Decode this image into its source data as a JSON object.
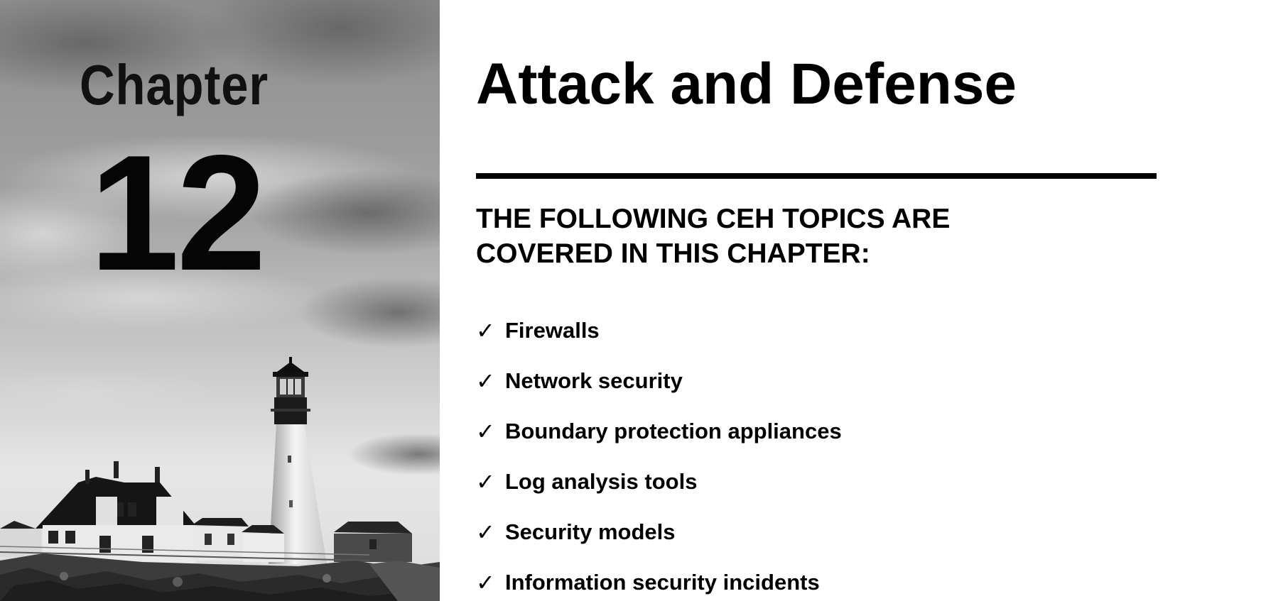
{
  "left_panel": {
    "chapter_label": "Chapter",
    "chapter_number": "12"
  },
  "right_panel": {
    "title": "Attack and Defense",
    "topics_heading_line1": "THE FOLLOWING CEH TOPICS ARE",
    "topics_heading_line2": "COVERED IN THIS CHAPTER:",
    "check_mark": "✓",
    "topics": [
      "Firewalls",
      "Network security",
      "Boundary protection appliances",
      "Log analysis tools",
      "Security models",
      "Information security incidents"
    ]
  },
  "icons": {
    "topic_bullet": "check-icon",
    "cover_image": "lighthouse-photo"
  }
}
